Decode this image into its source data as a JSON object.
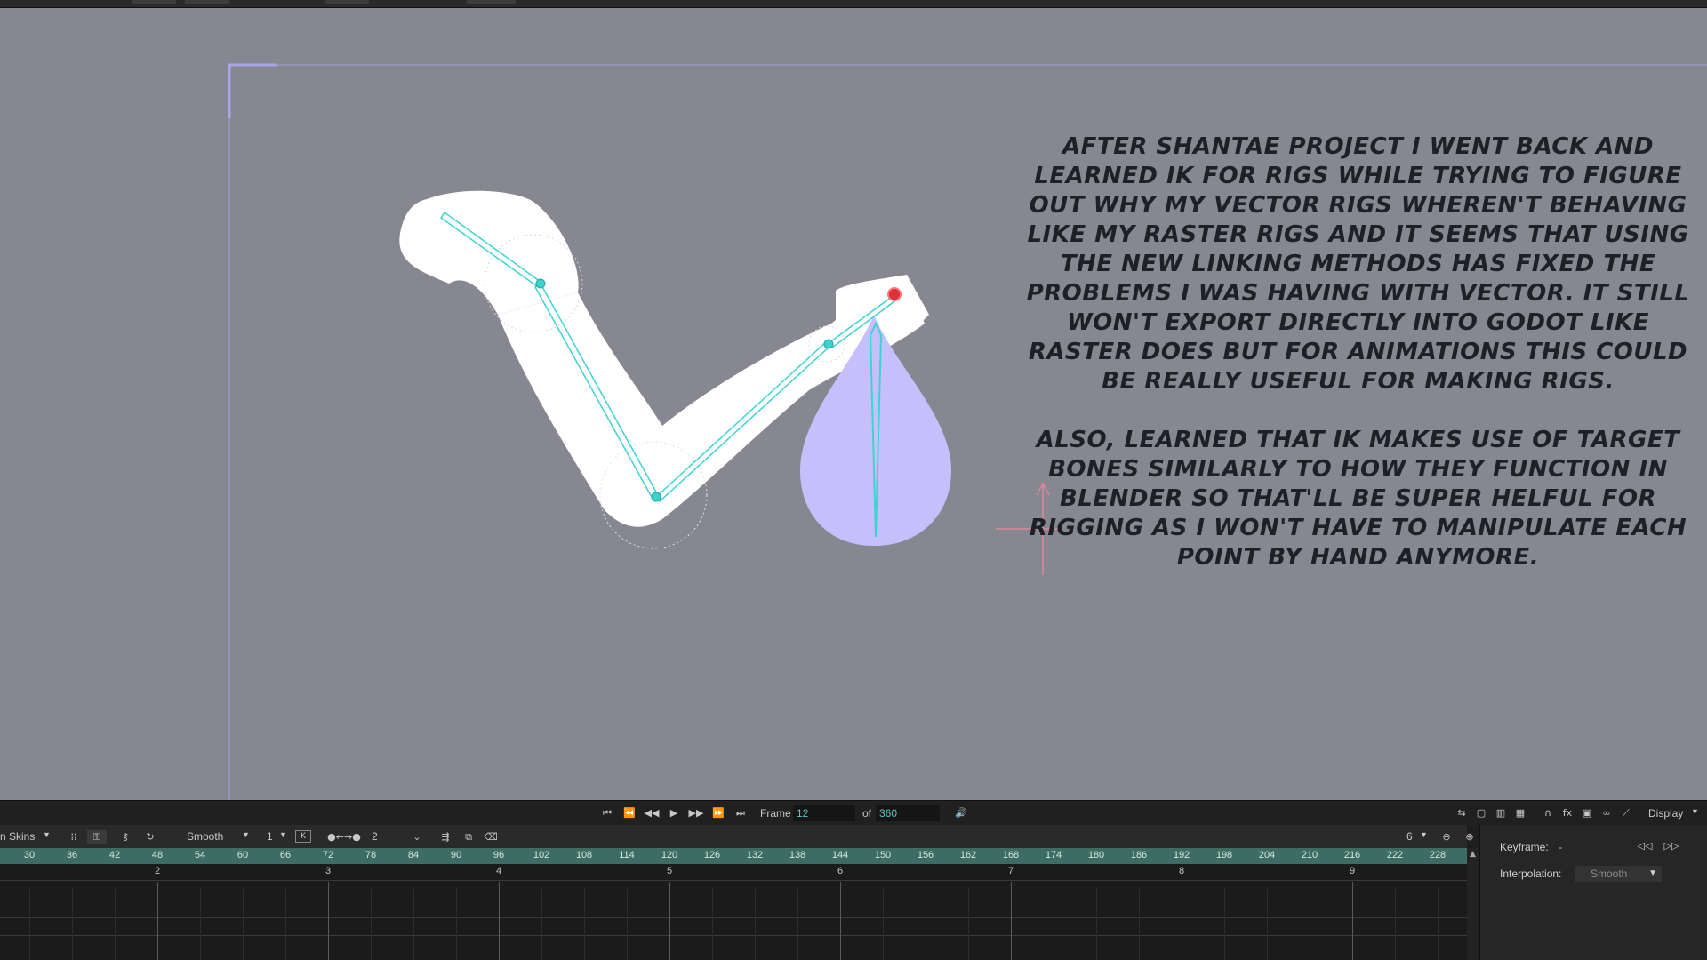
{
  "note": {
    "paragraph1": "After Shantae project I went back and learned IK for rigs while trying to figure out why my vector rigs wheren't behaving like my raster rigs and it seems that using the new linking methods has fixed the problems I was having with vector. It still won't export directly into Godot like raster does but for animations this could be really useful for making rigs.",
    "paragraph2": "Also, learned that IK makes use of target bones similarly to how they function in Blender so that'll be super helful for rigging as I won't have to manipulate each point by hand anymore."
  },
  "transport": {
    "frame_label": "Frame",
    "frame_value": "12",
    "of_label": "of",
    "total_frames": "360",
    "display_label": "Display"
  },
  "toolbar2": {
    "skins_label": "n Skins",
    "interp_label": "Smooth",
    "step_value": "1",
    "onion_value": "2",
    "zoom_value": "6"
  },
  "ruler": {
    "ticks": [
      "30",
      "36",
      "42",
      "48",
      "54",
      "60",
      "66",
      "72",
      "78",
      "84",
      "90",
      "96",
      "102",
      "108",
      "114",
      "120",
      "126",
      "132",
      "138",
      "144",
      "150",
      "156",
      "162",
      "168",
      "174",
      "180",
      "186",
      "192",
      "198",
      "204",
      "210",
      "216",
      "222",
      "228"
    ]
  },
  "tracks": {
    "seconds": [
      "2",
      "3",
      "4",
      "5",
      "6",
      "7",
      "8",
      "9"
    ]
  },
  "right_panel": {
    "keyframe_label": "Keyframe:",
    "keyframe_value": "-",
    "interpolation_label": "Interpolation:",
    "interpolation_value": "Smooth"
  },
  "colors": {
    "canvas_bg": "#878791",
    "bone": "#3fd3cf",
    "drop_fill": "#c7bffb",
    "target": "#e0303a",
    "ruler": "#3d6d62"
  }
}
